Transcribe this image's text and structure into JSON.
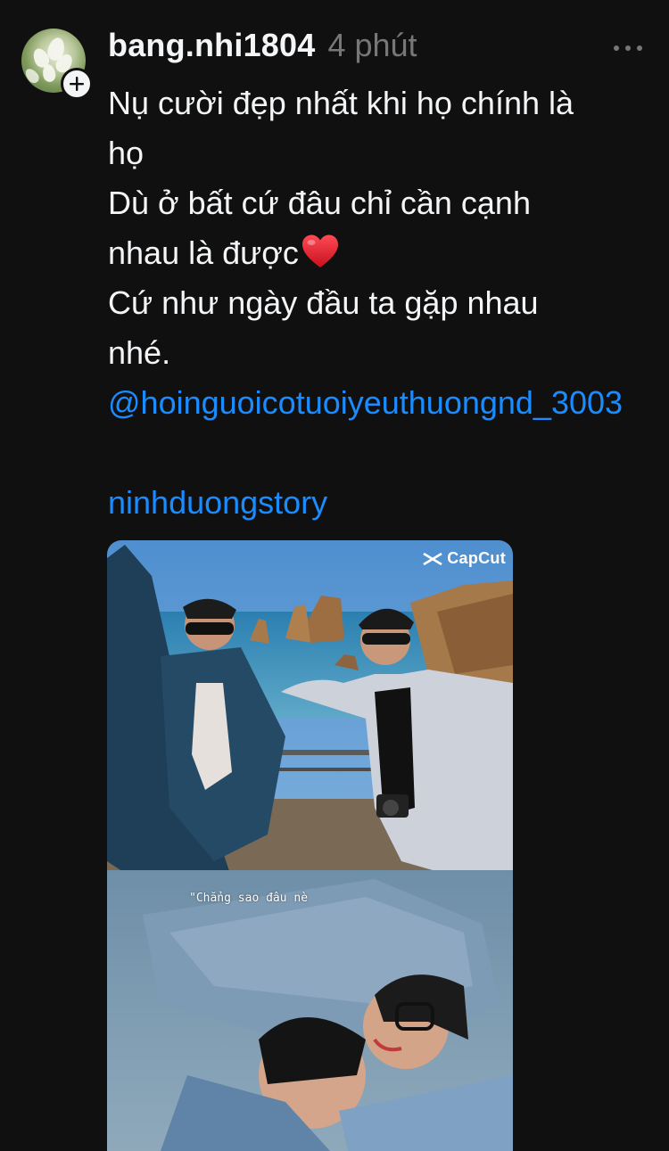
{
  "post": {
    "username": "bang.nhi1804",
    "timestamp": "4 phút",
    "caption_lines": [
      "Nụ cười đẹp nhất khi họ chính là",
      "họ",
      "Dù ở bất cứ đâu chỉ cần cạnh",
      "nhau là được",
      "Cứ như ngày đầu ta gặp nhau",
      "nhé."
    ],
    "mention": "@hoinguoicotuoiyeuthuongnd_3003",
    "tag": "ninhduongstory",
    "media": {
      "watermark": "CapCut",
      "overlay_text": "\"Chẳng sao đâu nè"
    }
  },
  "icons": {
    "follow": "plus-icon",
    "more": "more-horizontal-icon",
    "heart": "red-heart-emoji",
    "watermark_logo": "capcut-logo-icon"
  },
  "colors": {
    "background": "#101010",
    "text_primary": "#f3f5f7",
    "text_secondary": "#777777",
    "link": "#1a8cff",
    "heart": "#e0202e"
  }
}
